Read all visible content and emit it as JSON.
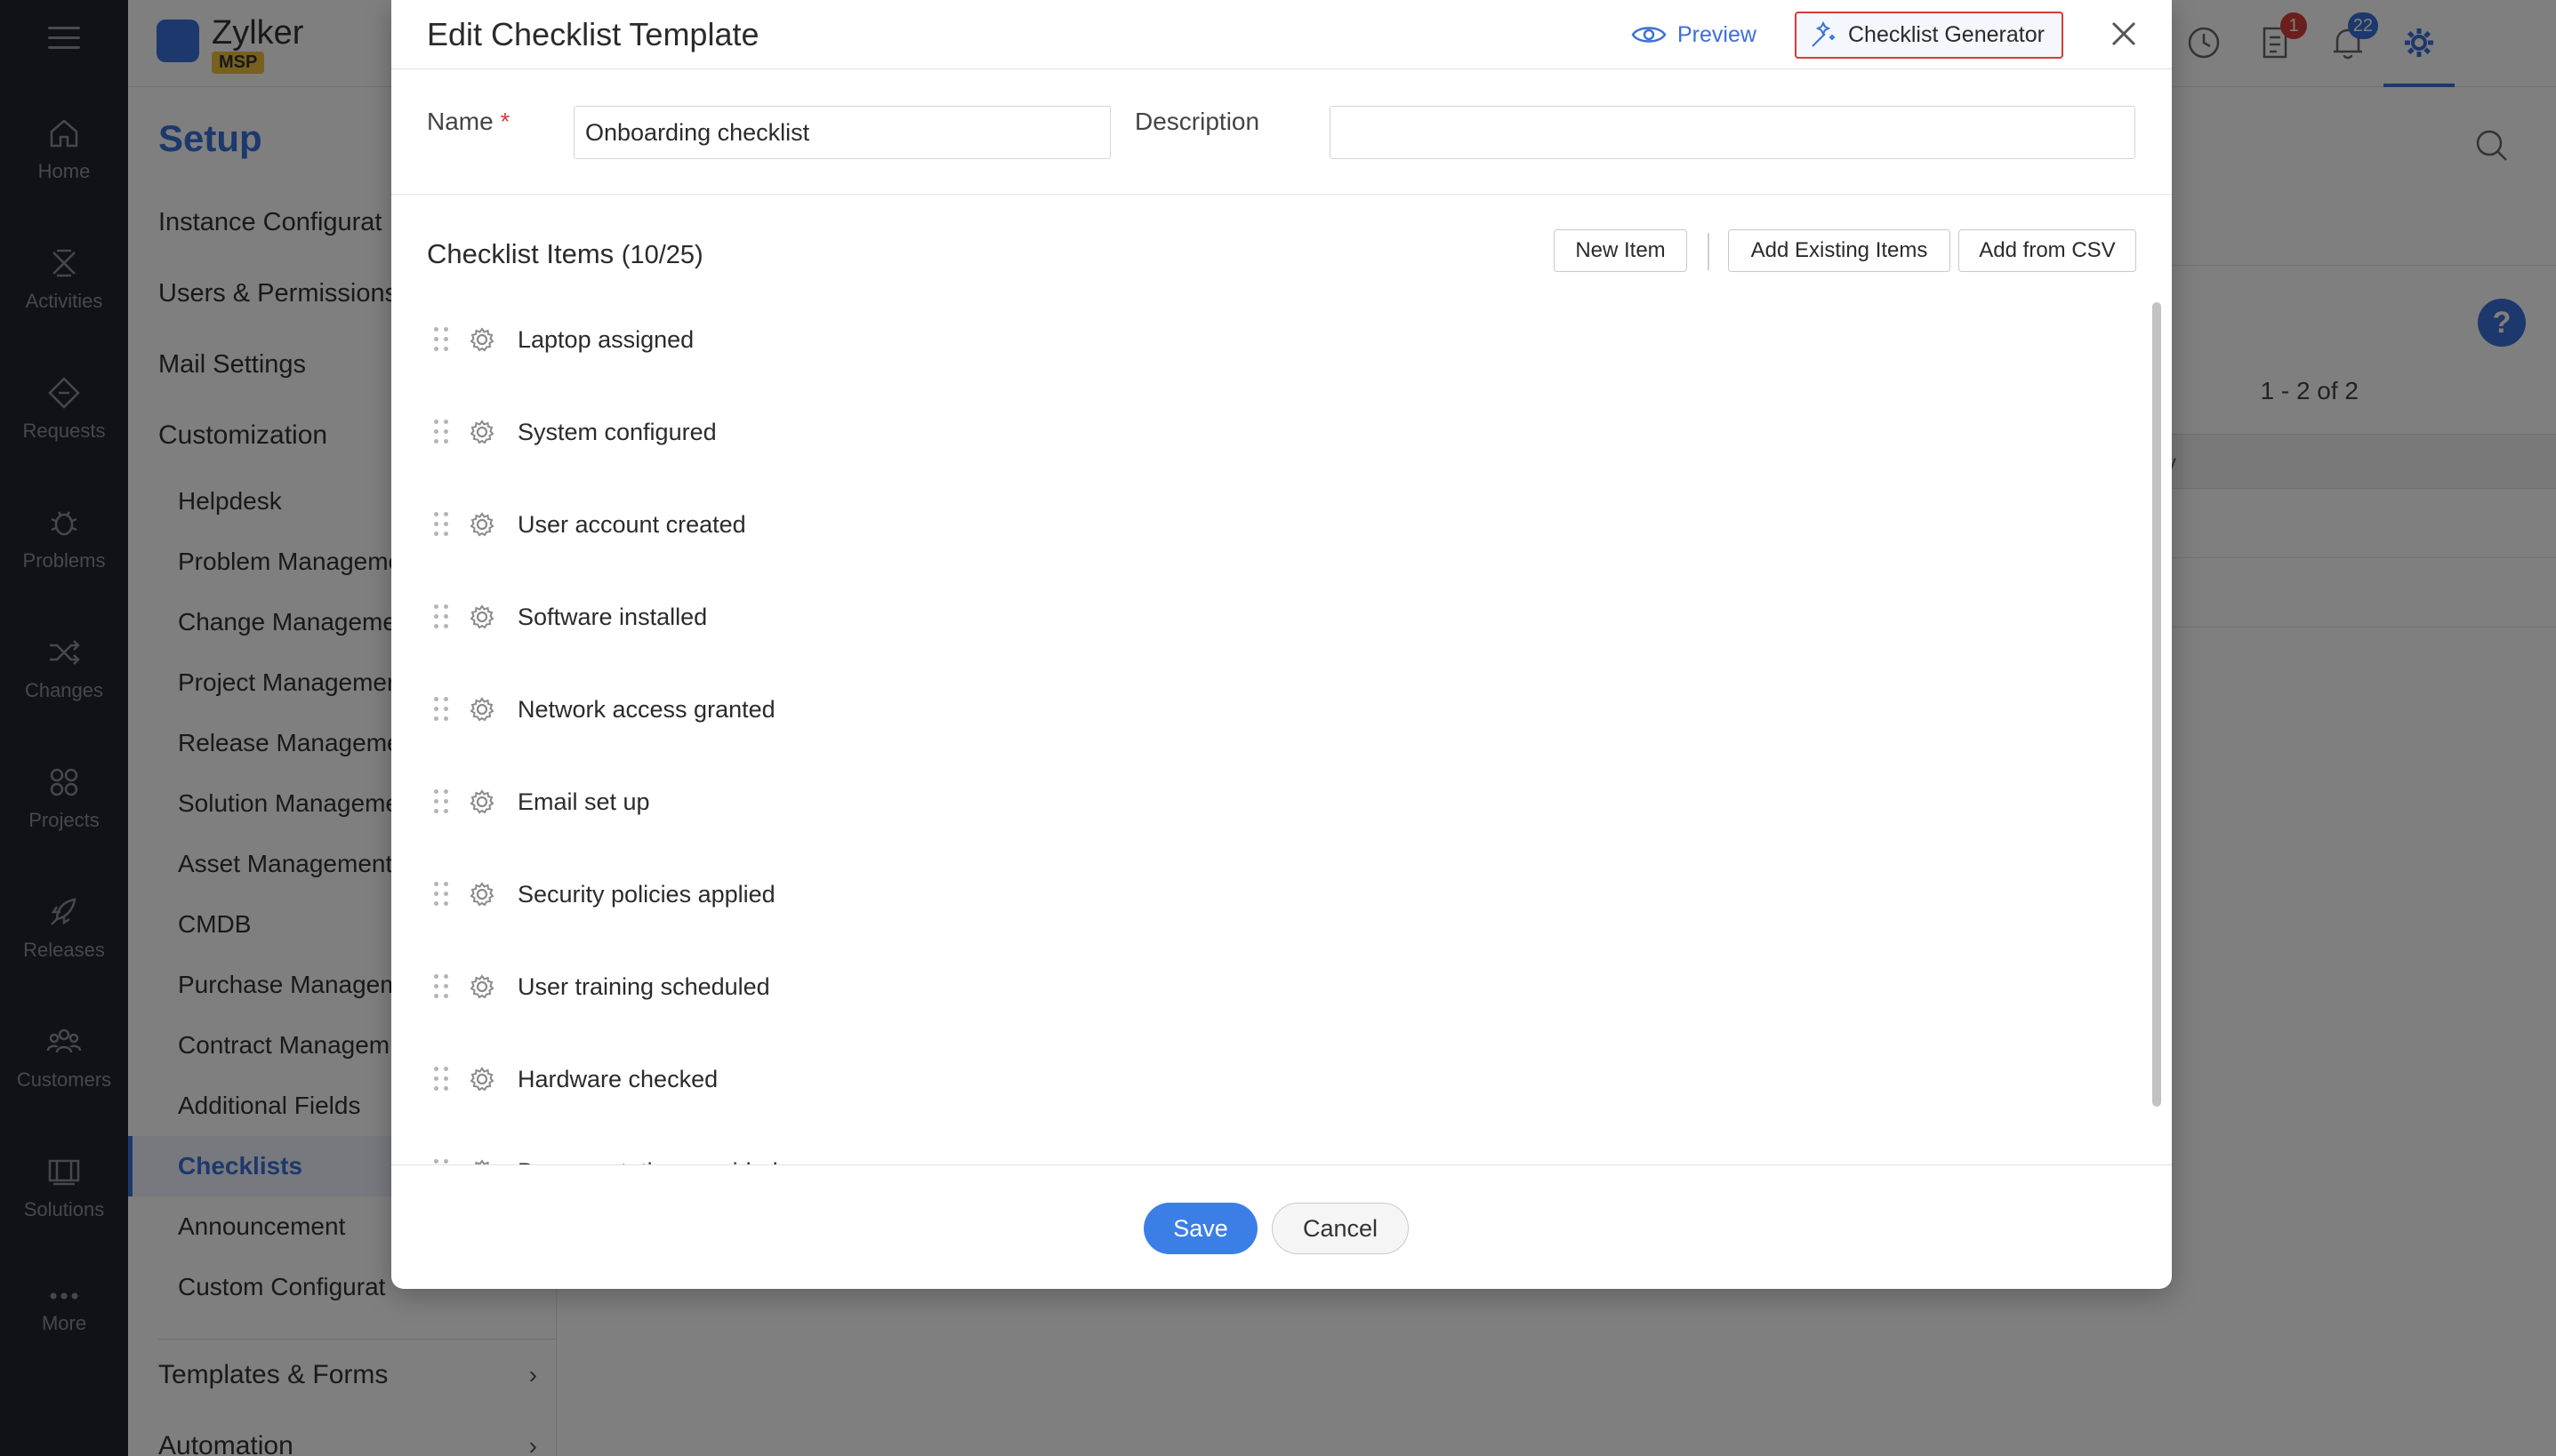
{
  "app": {
    "brand_name": "Zylker",
    "brand_badge": "MSP"
  },
  "leftnav": {
    "items": [
      {
        "label": "Home",
        "icon": "home-icon"
      },
      {
        "label": "Activities",
        "icon": "activities-icon"
      },
      {
        "label": "Requests",
        "icon": "requests-icon"
      },
      {
        "label": "Problems",
        "icon": "problems-icon"
      },
      {
        "label": "Changes",
        "icon": "changes-icon"
      },
      {
        "label": "Projects",
        "icon": "projects-icon"
      },
      {
        "label": "Releases",
        "icon": "releases-icon"
      },
      {
        "label": "Customers",
        "icon": "customers-icon"
      },
      {
        "label": "Solutions",
        "icon": "solutions-icon"
      },
      {
        "label": "More",
        "icon": "more-icon"
      }
    ]
  },
  "topbar": {
    "tasks_badge": "1",
    "notifications_badge": "22",
    "colors": {
      "accent": "#3b70d8",
      "badge_red": "#d93a3a",
      "badge_blue": "#3b70d8"
    }
  },
  "setup": {
    "title": "Setup",
    "top_items": [
      "Instance Configurat",
      "Users & Permissions",
      "Mail Settings"
    ],
    "section_customization": "Customization",
    "sub_items": [
      "Helpdesk",
      "Problem Manageme",
      "Change Manageme",
      "Project Managemer",
      "Release Manageme",
      "Solution Manageme",
      "Asset Management",
      "CMDB",
      "Purchase Managem",
      "Contract Managem",
      "Additional Fields",
      "Checklists",
      "Announcement",
      "Custom Configurat"
    ],
    "active_item": "Checklists",
    "templates_forms": "Templates & Forms",
    "automation": "Automation"
  },
  "main": {
    "pager": "1 - 2 of 2",
    "header_fragment": "y"
  },
  "modal": {
    "title": "Edit Checklist Template",
    "preview_label": "Preview",
    "generator_label": "Checklist Generator",
    "name_label": "Name",
    "required_mark": "*",
    "name_value": "Onboarding checklist",
    "description_label": "Description",
    "description_value": "",
    "items_title": "Checklist Items",
    "items_count": "(10/25)",
    "new_item_label": "New Item",
    "add_existing_label": "Add Existing Items",
    "add_csv_label": "Add from CSV",
    "items": [
      "Laptop assigned",
      "System configured",
      "User account created",
      "Software installed",
      "Network access granted",
      "Email set up",
      "Security policies applied",
      "User training scheduled",
      "Hardware checked",
      "Documentation provided"
    ],
    "save_label": "Save",
    "cancel_label": "Cancel"
  }
}
